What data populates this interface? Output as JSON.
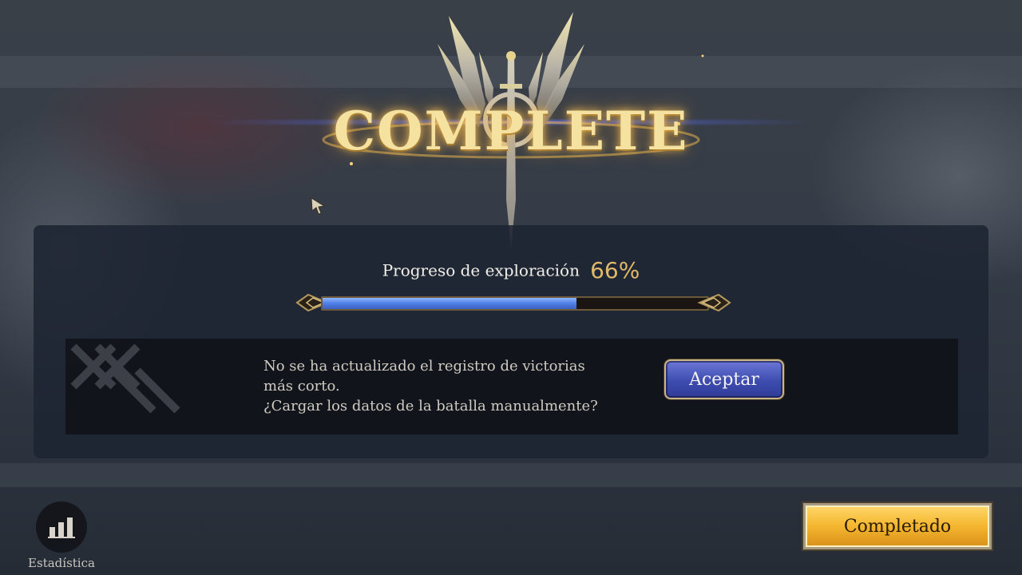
{
  "header": {
    "title": "COMPLETE"
  },
  "exploration": {
    "label": "Progreso de exploración",
    "value_text": "66%",
    "progress_fraction": 0.66
  },
  "notice": {
    "line1": "No se ha actualizado el registro de victorias",
    "line2": "más corto.",
    "line3": "¿Cargar los datos de la batalla manualmente?",
    "accept_label": "Aceptar"
  },
  "footer": {
    "stats_label": "Estadística",
    "completed_label": "Completado"
  },
  "colors": {
    "accent_gold": "#e0b96a",
    "progress_blue": "#4f7fe6",
    "accept_blue": "#3e4cb0",
    "completed_gold": "#f4b62e"
  },
  "icons": {
    "emblem": "winged-sword-emblem-icon",
    "stats": "bar-chart-icon",
    "cursor": "mouse-cursor-icon"
  }
}
